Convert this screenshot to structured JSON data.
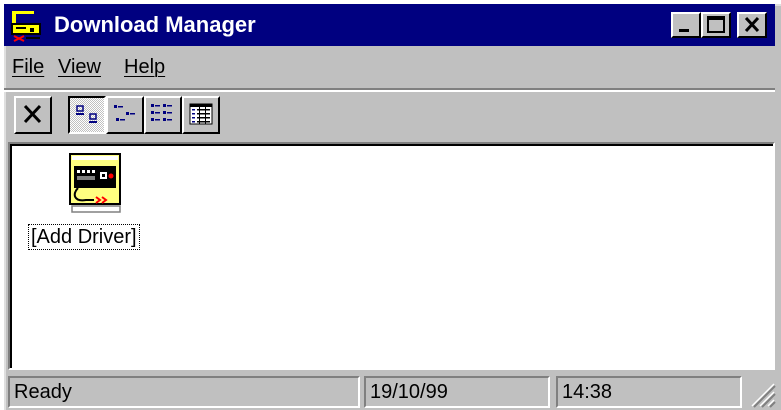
{
  "window": {
    "title": "Download Manager",
    "controls": {
      "minimize_icon": "minimize-icon",
      "maximize_icon": "maximize-icon",
      "close_icon": "close-icon"
    }
  },
  "menu": {
    "items": [
      {
        "label": "File",
        "accelerator": "F"
      },
      {
        "label": "View",
        "accelerator": "V"
      },
      {
        "label": "Help",
        "accelerator": "H"
      }
    ]
  },
  "toolbar": {
    "buttons": [
      {
        "icon": "delete-x-icon",
        "pressed": false
      },
      {
        "icon": "large-icons-view-icon",
        "pressed": true
      },
      {
        "icon": "small-icons-view-icon",
        "pressed": false
      },
      {
        "icon": "list-view-icon",
        "pressed": false
      },
      {
        "icon": "details-view-icon",
        "pressed": false
      }
    ]
  },
  "content": {
    "items": [
      {
        "label": "[Add Driver]",
        "icon": "add-driver-icon",
        "focused": true
      }
    ]
  },
  "status": {
    "message": "Ready",
    "date": "19/10/99",
    "time": "14:38"
  },
  "colors": {
    "titlebar": "#000080",
    "face": "#c0c0c0",
    "shadow": "#808080",
    "highlight": "#ffffff"
  }
}
